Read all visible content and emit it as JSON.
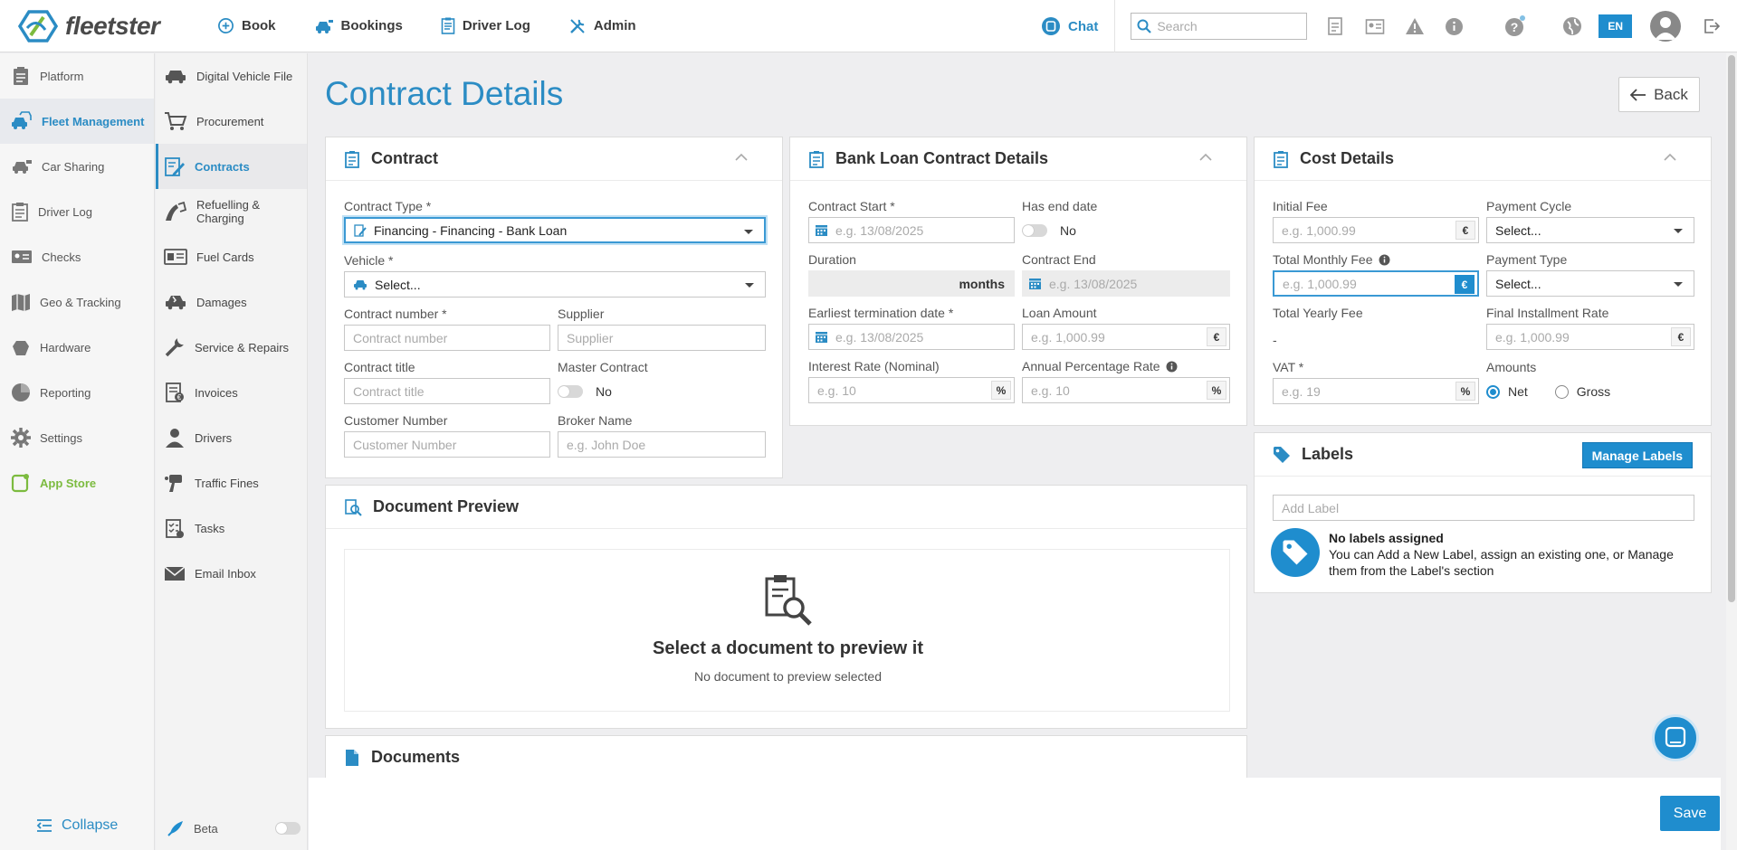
{
  "brand": {
    "name": "fleetster"
  },
  "topnav": {
    "items": [
      {
        "label": "Book",
        "icon": "plus-circle-icon"
      },
      {
        "label": "Bookings",
        "icon": "car-icon"
      },
      {
        "label": "Driver Log",
        "icon": "log-icon"
      },
      {
        "label": "Admin",
        "icon": "tools-icon"
      }
    ],
    "chat_label": "Chat",
    "search_placeholder": "Search",
    "language": "EN"
  },
  "sidebar": {
    "items": [
      {
        "label": "Platform",
        "icon": "clipboard-icon"
      },
      {
        "label": "Fleet Management",
        "icon": "fleet-icon"
      },
      {
        "label": "Car Sharing",
        "icon": "car-icon"
      },
      {
        "label": "Driver Log",
        "icon": "log-icon"
      },
      {
        "label": "Checks",
        "icon": "id-card-icon"
      },
      {
        "label": "Geo & Tracking",
        "icon": "map-icon"
      },
      {
        "label": "Hardware",
        "icon": "hardware-icon"
      },
      {
        "label": "Reporting",
        "icon": "pie-chart-icon"
      },
      {
        "label": "Settings",
        "icon": "gear-icon"
      },
      {
        "label": "App Store",
        "icon": "store-icon"
      }
    ],
    "collapse_label": "Collapse"
  },
  "subnav": {
    "items": [
      {
        "label": "Digital Vehicle File"
      },
      {
        "label": "Procurement"
      },
      {
        "label": "Contracts"
      },
      {
        "label": "Refuelling & Charging"
      },
      {
        "label": "Fuel Cards"
      },
      {
        "label": "Damages"
      },
      {
        "label": "Service & Repairs"
      },
      {
        "label": "Invoices"
      },
      {
        "label": "Drivers"
      },
      {
        "label": "Traffic Fines"
      },
      {
        "label": "Tasks"
      },
      {
        "label": "Email Inbox"
      }
    ],
    "beta_label": "Beta"
  },
  "page": {
    "title": "Contract Details",
    "back_label": "Back",
    "save_label": "Save"
  },
  "contract": {
    "title": "Contract",
    "contract_type_label": "Contract Type *",
    "contract_type_value": "Financing - Financing - Bank Loan",
    "vehicle_label": "Vehicle *",
    "vehicle_value": "Select...",
    "contract_number_label": "Contract number *",
    "contract_number_placeholder": "Contract number",
    "supplier_label": "Supplier",
    "supplier_placeholder": "Supplier",
    "contract_title_label": "Contract title",
    "contract_title_placeholder": "Contract title",
    "master_contract_label": "Master Contract",
    "master_contract_value": "No",
    "customer_number_label": "Customer Number",
    "customer_number_placeholder": "Customer Number",
    "broker_name_label": "Broker Name",
    "broker_name_placeholder": "e.g. John Doe"
  },
  "bank_loan": {
    "title": "Bank Loan Contract Details",
    "contract_start_label": "Contract Start *",
    "contract_start_placeholder": "e.g. 13/08/2025",
    "has_end_date_label": "Has end date",
    "has_end_date_value": "No",
    "duration_label": "Duration",
    "duration_unit": "months",
    "contract_end_label": "Contract End",
    "contract_end_placeholder": "e.g. 13/08/2025",
    "earliest_termination_label": "Earliest termination date *",
    "earliest_termination_placeholder": "e.g. 13/08/2025",
    "loan_amount_label": "Loan Amount",
    "loan_amount_placeholder": "e.g. 1,000.99",
    "currency": "€",
    "interest_rate_label": "Interest Rate (Nominal)",
    "interest_rate_placeholder": "e.g. 10",
    "apr_label": "Annual Percentage Rate",
    "apr_placeholder": "e.g. 10",
    "percent": "%"
  },
  "cost": {
    "title": "Cost Details",
    "initial_fee_label": "Initial Fee",
    "initial_fee_placeholder": "e.g. 1,000.99",
    "payment_cycle_label": "Payment Cycle",
    "payment_cycle_value": "Select...",
    "total_monthly_fee_label": "Total Monthly Fee",
    "total_monthly_fee_placeholder": "e.g. 1,000.99",
    "payment_type_label": "Payment Type",
    "payment_type_value": "Select...",
    "total_yearly_fee_label": "Total Yearly Fee",
    "total_yearly_fee_value": "-",
    "final_installment_label": "Final Installment Rate",
    "final_installment_placeholder": "e.g. 1,000.99",
    "vat_label": "VAT *",
    "vat_placeholder": "e.g. 19",
    "amounts_label": "Amounts",
    "amounts_net": "Net",
    "amounts_gross": "Gross",
    "currency": "€",
    "percent": "%"
  },
  "labels": {
    "title": "Labels",
    "manage_label": "Manage Labels",
    "add_placeholder": "Add Label",
    "empty_title": "No labels assigned",
    "empty_text": "You can Add a New Label, assign an existing one, or Manage them from the Label's section"
  },
  "preview": {
    "title": "Document Preview",
    "empty_title": "Select a document to preview it",
    "empty_text": "No document to preview selected"
  },
  "documents": {
    "title": "Documents"
  }
}
